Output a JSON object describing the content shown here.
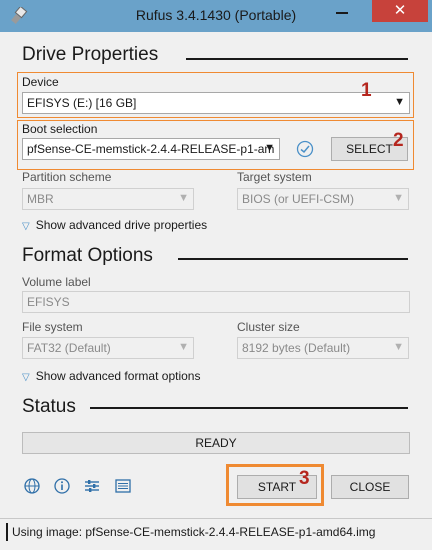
{
  "window": {
    "title": "Rufus 3.4.1430 (Portable)",
    "close_glyph": "✕"
  },
  "drive_properties": {
    "heading": "Drive Properties",
    "device_label": "Device",
    "device_value": "EFISYS (E:) [16 GB]",
    "boot_label": "Boot selection",
    "boot_value": "pfSense-CE-memstick-2.4.4-RELEASE-p1-am",
    "select_button": "SELECT",
    "partition_label": "Partition scheme",
    "partition_value": "MBR",
    "target_label": "Target system",
    "target_value": "BIOS (or UEFI-CSM)",
    "advanced_link": "Show advanced drive properties"
  },
  "format_options": {
    "heading": "Format Options",
    "volume_label": "Volume label",
    "volume_value": "EFISYS",
    "fs_label": "File system",
    "fs_value": "FAT32 (Default)",
    "cluster_label": "Cluster size",
    "cluster_value": "8192 bytes (Default)",
    "advanced_link": "Show advanced format options"
  },
  "status": {
    "heading": "Status",
    "text": "READY"
  },
  "actions": {
    "start": "START",
    "close": "CLOSE"
  },
  "annotations": {
    "step1": "1",
    "step2": "2",
    "step3": "3",
    "highlight_color": "#ef8a32",
    "number_color": "#b5261e"
  },
  "footer": {
    "text": "Using image: pfSense-CE-memstick-2.4.4-RELEASE-p1-amd64.img"
  },
  "icons": [
    "usb-icon",
    "globe-icon",
    "info-icon",
    "settings-icon",
    "log-icon",
    "check-icon"
  ]
}
